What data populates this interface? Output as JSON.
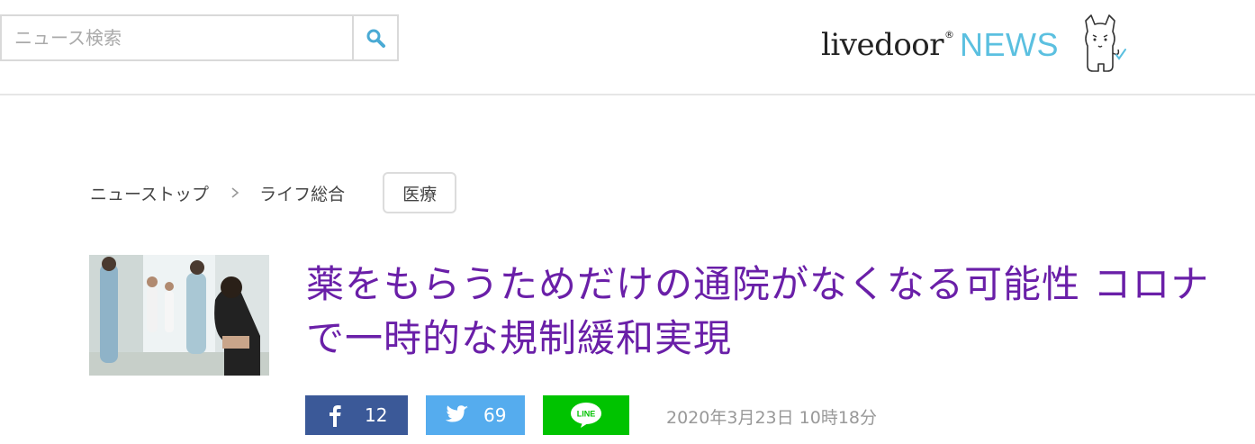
{
  "search": {
    "placeholder": "ニュース検索",
    "value": ""
  },
  "logo": {
    "brand": "livedoor",
    "registered_mark": "®",
    "product": "NEWS",
    "mascot_icon": "dog-mascot-icon",
    "accent_color": "#5bc0e0"
  },
  "breadcrumb": {
    "items": [
      "ニューストップ",
      "ライフ総合"
    ],
    "separator_icon": "chevron-right-icon",
    "tag": "医療"
  },
  "article": {
    "title": "薬をもらうためだけの通院がなくなる可能性 コロナで一時的な規制緩和実現",
    "title_color": "#6a1fa8",
    "date": "2020年3月23日 10時18分"
  },
  "share": {
    "facebook": {
      "icon": "facebook-icon",
      "count": "12",
      "color": "#3b5998"
    },
    "twitter": {
      "icon": "twitter-icon",
      "count": "69",
      "color": "#55acee"
    },
    "line": {
      "icon": "line-icon",
      "label": "LINE",
      "color": "#00c300"
    }
  }
}
